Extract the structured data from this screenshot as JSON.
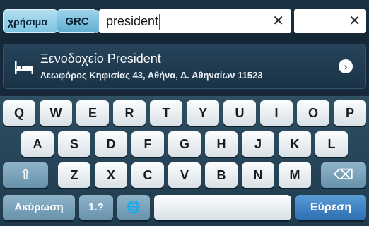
{
  "search_bar": {
    "chip_useful": "χρήσιμα",
    "chip_region": "GRC",
    "query": "president",
    "clear_glyph": "✕",
    "side_clear_glyph": "✕"
  },
  "suggestion": {
    "icon": "bed-icon",
    "title": "Ξενοδοχείο President",
    "address": "Λεωφόρος Κηφισίας 43, Αθήνα, Δ. Αθηναίων 11523",
    "go_glyph": "›"
  },
  "keyboard": {
    "row1": [
      "Q",
      "W",
      "E",
      "R",
      "T",
      "Y",
      "U",
      "I",
      "O",
      "P"
    ],
    "row2": [
      "A",
      "S",
      "D",
      "F",
      "G",
      "H",
      "J",
      "K",
      "L"
    ],
    "row3": [
      "Z",
      "X",
      "C",
      "V",
      "B",
      "N",
      "M"
    ],
    "shift_glyph": "⇧",
    "backspace_glyph": "⌫",
    "cancel_label": "Ακύρωση",
    "numbers_label": "1.?",
    "globe_glyph": "🌐",
    "space_label": "",
    "search_label": "Εύρεση"
  }
}
